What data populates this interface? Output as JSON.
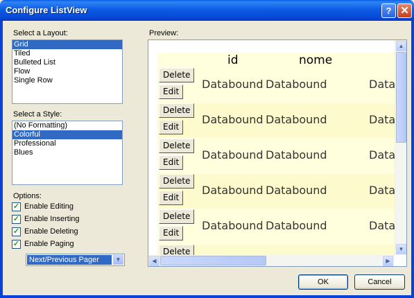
{
  "window": {
    "title": "Configure ListView",
    "help_glyph": "?",
    "close_glyph": "✕"
  },
  "layout": {
    "label": "Select a Layout:",
    "items": [
      "Grid",
      "Tiled",
      "Bulleted List",
      "Flow",
      "Single Row"
    ],
    "selected": "Grid"
  },
  "style": {
    "label": "Select a Style:",
    "items": [
      "(No Formatting)",
      "Colorful",
      "Professional",
      "Blues"
    ],
    "selected": "Colorful"
  },
  "options": {
    "label": "Options:",
    "items": [
      {
        "label": "Enable Editing",
        "checked": true
      },
      {
        "label": "Enable Inserting",
        "checked": true
      },
      {
        "label": "Enable Deleting",
        "checked": true
      },
      {
        "label": "Enable Paging",
        "checked": true
      }
    ],
    "pager_value": "Next/Previous Pager"
  },
  "preview": {
    "label": "Preview:",
    "columns": [
      "id",
      "nome"
    ],
    "delete_label": "Delete",
    "edit_label": "Edit",
    "rows": [
      [
        "Databound",
        "Databound",
        "Data"
      ],
      [
        "Databound",
        "Databound",
        "Data"
      ],
      [
        "Databound",
        "Databound",
        "Data"
      ],
      [
        "Databound",
        "Databound",
        "Data"
      ],
      [
        "Databound",
        "Databound",
        "Data"
      ]
    ],
    "partial_row_label": "Delete"
  },
  "buttons": {
    "ok": "OK",
    "cancel": "Cancel"
  },
  "colors": {
    "titlebar": "#0a5ee6",
    "selection": "#316ac5",
    "preview_background": "#ffffdd"
  }
}
